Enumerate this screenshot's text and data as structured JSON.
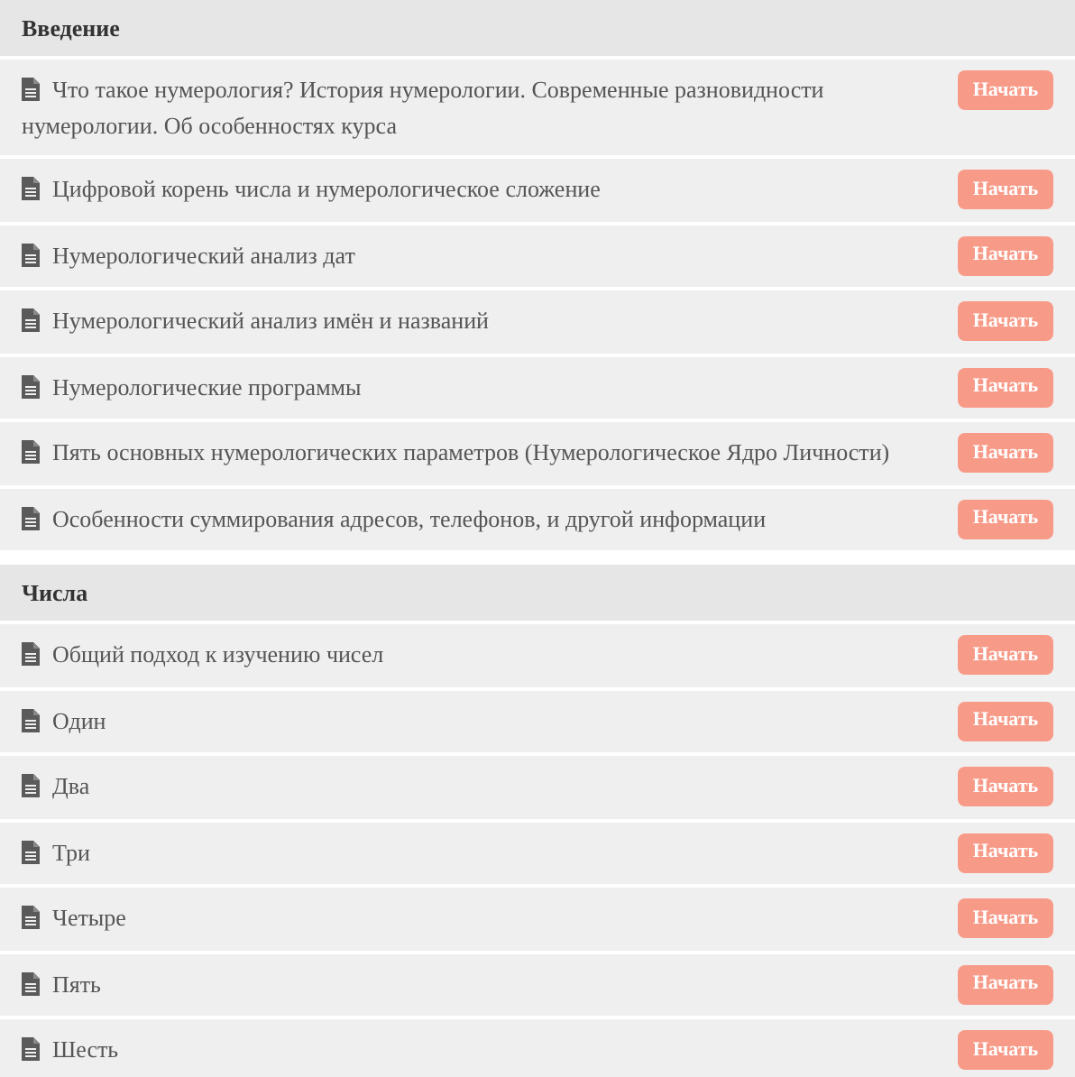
{
  "sections": [
    {
      "title": "Введение",
      "lessons": [
        {
          "title": "Что такое нумерология? История нумерологии. Современные разновидности нумерологии. Об особенностях курса",
          "button": "Начать"
        },
        {
          "title": "Цифровой корень числа и нумерологическое сложение",
          "button": "Начать"
        },
        {
          "title": "Нумерологический анализ дат",
          "button": "Начать"
        },
        {
          "title": "Нумерологический анализ имён и названий",
          "button": "Начать"
        },
        {
          "title": "Нумерологические программы",
          "button": "Начать"
        },
        {
          "title": "Пять основных нумерологических параметров (Нумерологическое Ядро Личности)",
          "button": "Начать"
        },
        {
          "title": "Особенности суммирования адресов, телефонов, и другой информации",
          "button": "Начать"
        }
      ]
    },
    {
      "title": "Числа",
      "lessons": [
        {
          "title": "Общий подход к изучению чисел",
          "button": "Начать"
        },
        {
          "title": "Один",
          "button": "Начать"
        },
        {
          "title": "Два",
          "button": "Начать"
        },
        {
          "title": "Три",
          "button": "Начать"
        },
        {
          "title": "Четыре",
          "button": "Начать"
        },
        {
          "title": "Пять",
          "button": "Начать"
        },
        {
          "title": "Шесть",
          "button": "Начать"
        }
      ]
    }
  ]
}
